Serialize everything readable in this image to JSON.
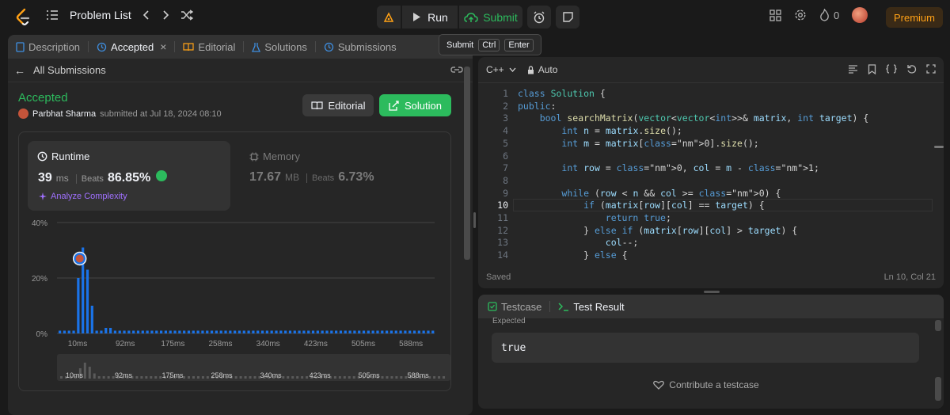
{
  "topbar": {
    "problem_list": "Problem List",
    "run_label": "Run",
    "submit_label": "Submit",
    "streak_count": "0",
    "premium_label": "Premium"
  },
  "tooltip": {
    "label": "Submit",
    "key1": "Ctrl",
    "key2": "Enter"
  },
  "left_tabs": {
    "description": "Description",
    "accepted": "Accepted",
    "editorial": "Editorial",
    "solutions": "Solutions",
    "submissions": "Submissions"
  },
  "all_submissions": "All Submissions",
  "result": {
    "status": "Accepted",
    "user": "Parbhat Sharma",
    "submitted_text": "submitted at Jul 18, 2024 08:10",
    "editorial_btn": "Editorial",
    "solution_btn": "Solution"
  },
  "runtime": {
    "title": "Runtime",
    "value": "39",
    "unit": "ms",
    "beats_label": "Beats",
    "beats_value": "86.85%",
    "analyze": "Analyze Complexity"
  },
  "memory": {
    "title": "Memory",
    "value": "17.67",
    "unit": "MB",
    "beats_label": "Beats",
    "beats_value": "6.73%"
  },
  "chart_data": {
    "type": "bar",
    "y_ticks": [
      "40%",
      "20%",
      "0%"
    ],
    "ylim": [
      0,
      40
    ],
    "x_ticks": [
      "10ms",
      "92ms",
      "175ms",
      "258ms",
      "340ms",
      "423ms",
      "505ms",
      "588ms"
    ],
    "values": [
      1,
      1,
      1,
      1,
      20,
      31,
      23,
      10,
      1,
      1,
      2,
      2,
      1,
      1,
      1,
      1,
      1,
      1,
      1,
      1,
      1,
      1,
      1,
      1,
      1,
      1,
      1,
      1,
      1,
      1,
      1,
      1,
      1,
      1,
      1,
      1,
      1,
      1,
      1,
      1,
      1,
      1,
      1,
      1,
      1,
      1,
      1,
      1,
      1,
      1,
      1,
      1,
      1,
      1,
      1,
      1,
      1,
      1,
      1,
      1,
      1,
      1,
      1,
      1,
      1,
      1,
      1,
      1,
      1,
      1,
      1,
      1,
      1,
      1,
      1,
      1,
      1,
      1,
      1,
      1,
      1,
      1
    ],
    "highlight_index": 5
  },
  "editor": {
    "language": "C++",
    "mode": "Auto",
    "status_left": "Saved",
    "status_right": "Ln 10, Col 21",
    "lines": [
      "class Solution {",
      "public:",
      "    bool searchMatrix(vector<vector<int>>& matrix, int target) {",
      "        int n = matrix.size();",
      "        int m = matrix[0].size();",
      "",
      "        int row = 0, col = m - 1;",
      "",
      "        while (row < n && col >= 0) {",
      "            if (matrix[row][col] == target) {",
      "                return true;",
      "            } else if (matrix[row][col] > target) {",
      "                col--;",
      "            } else {"
    ]
  },
  "bottom": {
    "testcase_tab": "Testcase",
    "result_tab": "Test Result",
    "expected_label": "Expected",
    "expected_value": "true",
    "contribute": "Contribute a testcase"
  }
}
